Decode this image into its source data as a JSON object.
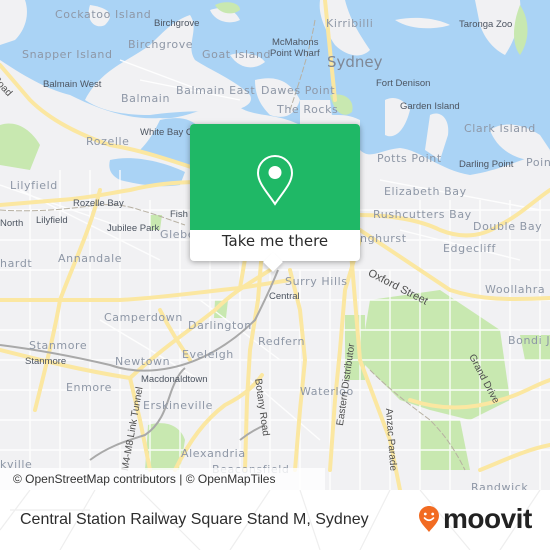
{
  "map": {
    "colors": {
      "water": "#aad3f5",
      "land": "#f1f1f3",
      "park": "#c8e8b0",
      "major_road": "#fbe7a1",
      "minor_road": "#ffffff",
      "rail": "#a9a9a9"
    },
    "place_labels": [
      {
        "id": "cockatoo-island",
        "text": "Cockatoo Island"
      },
      {
        "id": "birchgrove-small",
        "text": "Birchgrove"
      },
      {
        "id": "kirribilli",
        "text": "Kirribilli"
      },
      {
        "id": "taronga-zoo",
        "text": "Taronga Zoo"
      },
      {
        "id": "snapper-island",
        "text": "Snapper Island"
      },
      {
        "id": "birchgrove",
        "text": "Birchgrove"
      },
      {
        "id": "goat-island",
        "text": "Goat Island"
      },
      {
        "id": "mcmahons-point-wharf-1",
        "text": "McMahons"
      },
      {
        "id": "mcmahons-point-wharf-2",
        "text": "Point Wharf"
      },
      {
        "id": "sydney",
        "text": "Sydney"
      },
      {
        "id": "balmain-west",
        "text": "Balmain West"
      },
      {
        "id": "balmain-east",
        "text": "Balmain East"
      },
      {
        "id": "dawes-point",
        "text": "Dawes Point"
      },
      {
        "id": "fort-denison",
        "text": "Fort Denison"
      },
      {
        "id": "balmain",
        "text": "Balmain"
      },
      {
        "id": "the-rocks",
        "text": "The Rocks"
      },
      {
        "id": "garden-island",
        "text": "Garden Island"
      },
      {
        "id": "white-bay",
        "text": "White Bay C"
      },
      {
        "id": "rozelle",
        "text": "Rozelle"
      },
      {
        "id": "clark-island",
        "text": "Clark Island"
      },
      {
        "id": "potts-point",
        "text": "Potts Point"
      },
      {
        "id": "darling-point",
        "text": "Darling Point"
      },
      {
        "id": "point-partial",
        "text": "Poin"
      },
      {
        "id": "lilyfield",
        "text": "Lilyfield"
      },
      {
        "id": "elizabeth-bay",
        "text": "Elizabeth Bay"
      },
      {
        "id": "rozelle-bay",
        "text": "Rozelle Bay"
      },
      {
        "id": "fish",
        "text": "Fish"
      },
      {
        "id": "rushcutters-bay",
        "text": "Rushcutters Bay"
      },
      {
        "id": "lilyfield-small",
        "text": "Lilyfield"
      },
      {
        "id": "north",
        "text": "North"
      },
      {
        "id": "double-bay",
        "text": "Double Bay"
      },
      {
        "id": "jubilee-park",
        "text": "Jubilee Park"
      },
      {
        "id": "glebe",
        "text": "Glebe"
      },
      {
        "id": "darlinghurst",
        "text": "nghurst"
      },
      {
        "id": "edgecliff",
        "text": "Edgecliff"
      },
      {
        "id": "annandale",
        "text": "Annandale"
      },
      {
        "id": "leichhardt",
        "text": "hardt"
      },
      {
        "id": "surry-hills",
        "text": "Surry Hills"
      },
      {
        "id": "central",
        "text": "Central"
      },
      {
        "id": "woollahra",
        "text": "Woollahra"
      },
      {
        "id": "camperdown",
        "text": "Camperdown"
      },
      {
        "id": "darlington",
        "text": "Darlington"
      },
      {
        "id": "redfern",
        "text": "Redfern"
      },
      {
        "id": "bondi-junction",
        "text": "Bondi Ju"
      },
      {
        "id": "stanmore",
        "text": "Stanmore"
      },
      {
        "id": "stanmore-small",
        "text": "Stanmore"
      },
      {
        "id": "newtown",
        "text": "Newtown"
      },
      {
        "id": "eveleigh",
        "text": "Eveleigh"
      },
      {
        "id": "macdonaldtown",
        "text": "Macdonaldtown"
      },
      {
        "id": "enmore",
        "text": "Enmore"
      },
      {
        "id": "waterloo",
        "text": "Waterloo"
      },
      {
        "id": "erskineville",
        "text": "Erskineville"
      },
      {
        "id": "alexandria",
        "text": "Alexandria"
      },
      {
        "id": "marrickville",
        "text": "kville"
      },
      {
        "id": "beaconsfield",
        "text": "Beaconsfield"
      },
      {
        "id": "randwick",
        "text": "Randwick"
      }
    ],
    "road_labels": [
      {
        "id": "victoria-road",
        "text": "ria Road"
      },
      {
        "id": "oxford-street",
        "text": "Oxford Street"
      },
      {
        "id": "eastern-distributor",
        "text": "Eastern Distributor"
      },
      {
        "id": "grand-drive",
        "text": "Grand Drive"
      },
      {
        "id": "botany-road",
        "text": "Botany Road"
      },
      {
        "id": "m4-m8-link-tunnel",
        "text": "M4-M8 Link Tunnel"
      },
      {
        "id": "anzac-parade",
        "text": "Anzac Parade"
      }
    ],
    "attribution": "© OpenStreetMap contributors | © OpenMapTiles"
  },
  "popup": {
    "icon": "location-pin-icon",
    "cta_label": "Take me there",
    "accent_color": "#1fb866"
  },
  "footer": {
    "stop_title": "Central Station Railway Square Stand M, Sydney",
    "brand": {
      "name": "moovit",
      "logo_icon": "moovit-smiley-pin-icon",
      "logo_color": "#f26b21"
    }
  }
}
